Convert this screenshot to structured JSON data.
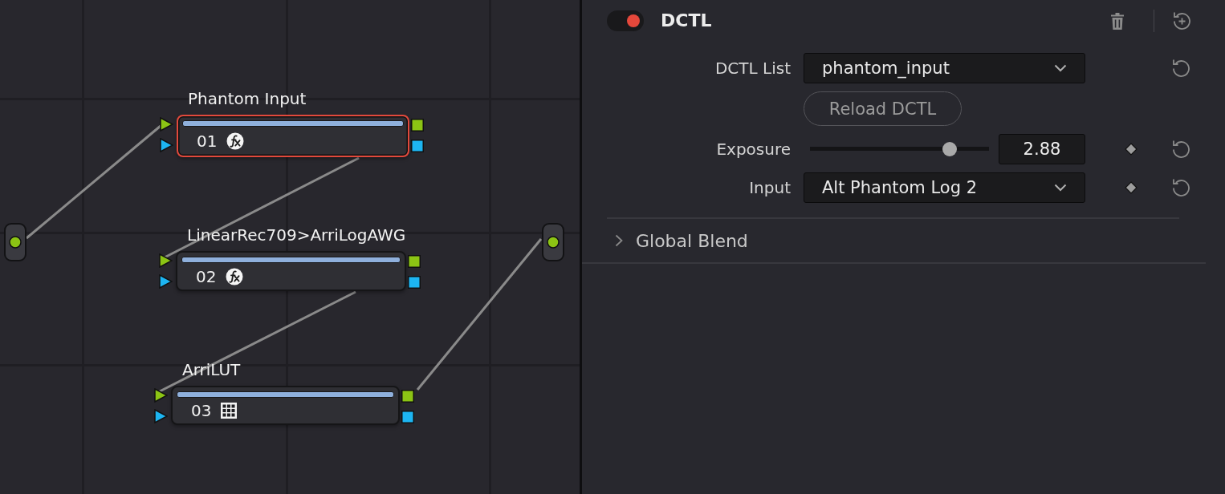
{
  "node_graph": {
    "nodes": [
      {
        "label": "Phantom Input",
        "number": "01",
        "kind": "dctl",
        "selected": true
      },
      {
        "label": "LinearRec709>ArriLogAWG",
        "number": "02",
        "kind": "dctl",
        "selected": false
      },
      {
        "label": "ArriLUT",
        "number": "03",
        "kind": "lut",
        "selected": false
      }
    ]
  },
  "inspector": {
    "enabled": true,
    "title": "DCTL",
    "parameters": [
      {
        "kind": "dropdown",
        "label": "DCTL List",
        "value": "phantom_input"
      },
      {
        "kind": "button",
        "label": "Reload DCTL"
      },
      {
        "kind": "slider",
        "label": "Exposure",
        "level": 0.78,
        "value": "2.88",
        "keyframe": true
      },
      {
        "kind": "dropdown",
        "label": "Input",
        "value": "Alt Phantom Log 2",
        "keyframe": true
      }
    ],
    "sections": [
      {
        "label": "Global Blend",
        "expanded": false
      }
    ]
  }
}
